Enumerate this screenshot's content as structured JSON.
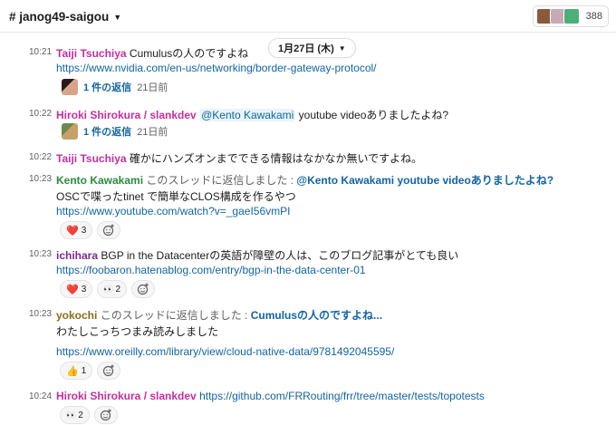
{
  "header": {
    "channel": "# janog49-saigou",
    "member_count": "388"
  },
  "date_divider": {
    "label": "1月27日 (木)"
  },
  "messages": [
    {
      "time": "10:21",
      "author": "Taiji Tsuchiya",
      "text": "Cumulusの人のですよね",
      "link": "https://www.nvidia.com/en-us/networking/border-gateway-protocol/",
      "thread": {
        "count": "1 件の返信",
        "ago": "21日前"
      }
    },
    {
      "time": "10:22",
      "author": "Hiroki Shirokura / slankdev",
      "mention": "@Kento Kawakami",
      "text": "youtube videoありましたよね?",
      "thread": {
        "count": "1 件の返信",
        "ago": "21日前"
      }
    },
    {
      "time": "10:22",
      "author": "Taiji Tsuchiya",
      "text": "確かにハンズオンまでできる情報はなかなか無いですよね。"
    },
    {
      "time": "10:23",
      "author": "Kento Kawakami",
      "reply_prefix": "このスレッドに返信しました :",
      "reply_quote": "@Kento Kawakami youtube videoありましたよね?",
      "text": "OSCで喋ったtinet で簡単なCLOS構成を作るやつ",
      "link": "https://www.youtube.com/watch?v=_gaeI56vmPI",
      "reactions": [
        {
          "emoji": "❤️",
          "count": "3"
        }
      ]
    },
    {
      "time": "10:23",
      "author": "ichihara",
      "text": "BGP in the Datacenterの英語が障壁の人は、このブログ記事がとても良い",
      "link": "https://foobaron.hatenablog.com/entry/bgp-in-the-data-center-01",
      "reactions": [
        {
          "emoji": "❤️",
          "count": "3"
        },
        {
          "emoji": "👀",
          "count": "2"
        }
      ]
    },
    {
      "time": "10:23",
      "author": "yokochi",
      "reply_prefix": "このスレッドに返信しました :",
      "reply_quote": "Cumulusの人のですよね...",
      "text": "わたしこっちつまみ読みしました",
      "link": "https://www.oreilly.com/library/view/cloud-native-data/9781492045595/",
      "reactions": [
        {
          "emoji": "👍",
          "count": "1"
        }
      ]
    },
    {
      "time": "10:24",
      "author": "Hiroki Shirokura / slankdev",
      "link": "https://github.com/FRRouting/frr/tree/master/tests/topotests",
      "reactions": [
        {
          "emoji": "👀",
          "count": "2"
        }
      ]
    }
  ]
}
